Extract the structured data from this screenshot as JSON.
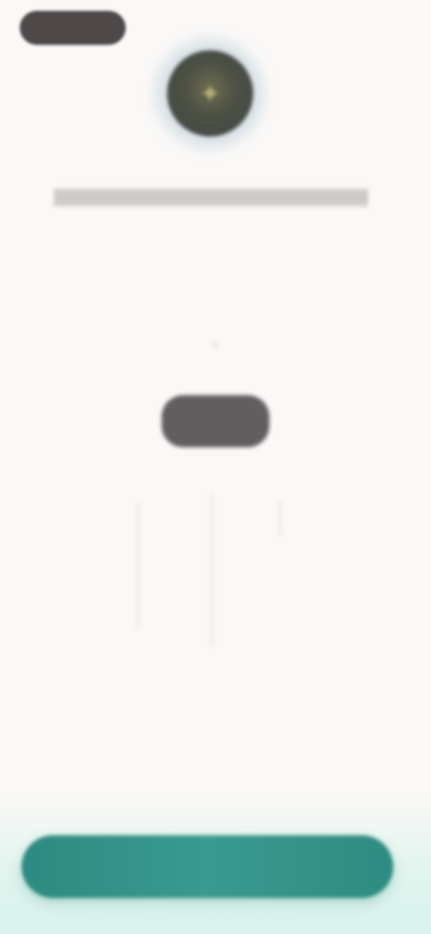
{
  "header": {
    "back_label": "",
    "right_link": ""
  },
  "profile": {
    "title": "",
    "subtitle": ""
  },
  "picker": {
    "selected_value": "",
    "scale_labels": [
      "",
      "",
      "",
      ""
    ]
  },
  "footer": {
    "cta_label": ""
  },
  "icons": {
    "back": "chevron-left-icon",
    "avatar": "avatar-icon"
  },
  "colors": {
    "background": "#fbf9f7",
    "back_pill": "#4e4849",
    "center_chip": "#625d5e",
    "cta": "#3a9a8f",
    "bottom_glow": "#d9f2ec"
  }
}
